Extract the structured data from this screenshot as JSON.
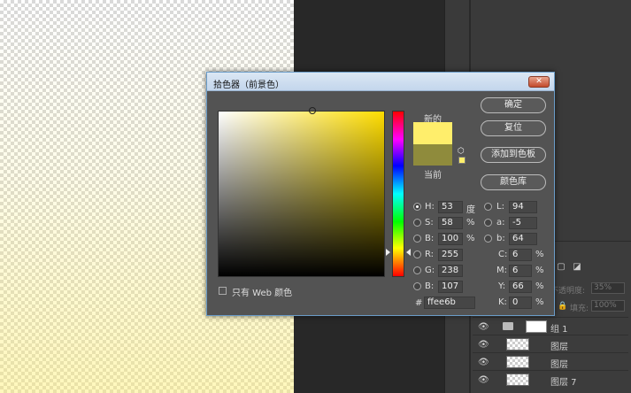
{
  "dialog": {
    "title": "拾色器（前景色）",
    "close_label": "✕",
    "new_label": "新的",
    "current_label": "当前",
    "new_color": "#ffee6b",
    "current_color": "#8f8b3c",
    "only_web_label": "只有 Web 颜色",
    "buttons": {
      "ok": "确定",
      "reset": "复位",
      "add_swatch": "添加到色板",
      "color_library": "颜色库"
    },
    "hsb": {
      "h": {
        "label": "H:",
        "value": "53",
        "unit": "度"
      },
      "s": {
        "label": "S:",
        "value": "58",
        "unit": "%"
      },
      "b": {
        "label": "B:",
        "value": "100",
        "unit": "%"
      }
    },
    "rgb": {
      "r": {
        "label": "R:",
        "value": "255"
      },
      "g": {
        "label": "G:",
        "value": "238"
      },
      "b": {
        "label": "B:",
        "value": "107"
      }
    },
    "lab": {
      "l": {
        "label": "L:",
        "value": "94"
      },
      "a": {
        "label": "a:",
        "value": "-5"
      },
      "b": {
        "label": "b:",
        "value": "64"
      }
    },
    "cmyk": {
      "c": {
        "label": "C:",
        "value": "6",
        "unit": "%"
      },
      "m": {
        "label": "M:",
        "value": "6",
        "unit": "%"
      },
      "y": {
        "label": "Y:",
        "value": "66",
        "unit": "%"
      },
      "k": {
        "label": "K:",
        "value": "0",
        "unit": "%"
      }
    },
    "hex": {
      "label": "#",
      "value": "ffee6b"
    }
  },
  "layers_panel": {
    "opacity_label": "不透明度:",
    "opacity_value": "35%",
    "fill_label": "填充:",
    "fill_value": "100%",
    "group_name": "组 1",
    "layer_names": [
      "图层",
      "图层",
      "图层 7"
    ]
  },
  "colors": {
    "hue_accent": "#ffdd00"
  }
}
